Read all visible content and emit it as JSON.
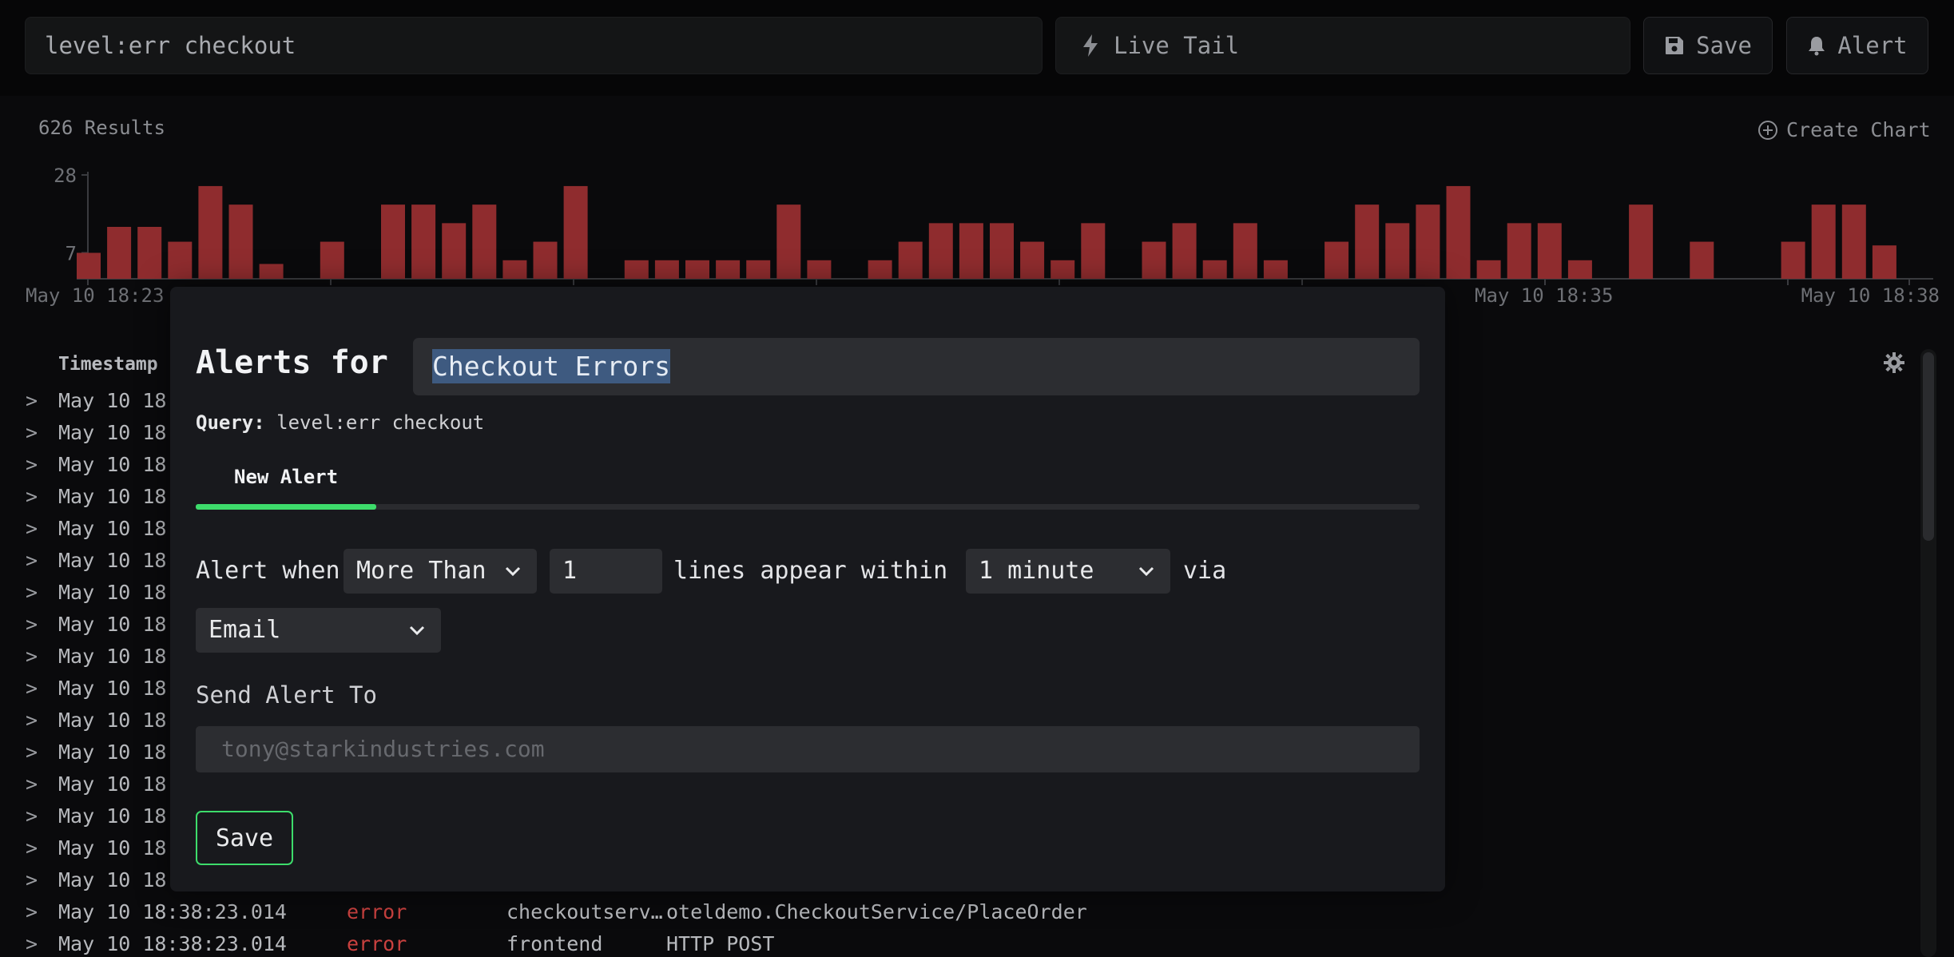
{
  "topbar": {
    "query": "level:err checkout",
    "live_tail": "Live Tail",
    "save": "Save",
    "alert": "Alert"
  },
  "results": {
    "count": "626 Results",
    "create_chart": "Create Chart"
  },
  "chart_data": {
    "type": "bar",
    "y_ticks": [
      "28",
      "7"
    ],
    "x_ticks": [
      "May 10 18:23",
      "May 10 18:35",
      "May 10 18:38"
    ],
    "ylim": [
      0,
      28
    ],
    "values": [
      7,
      14,
      14,
      10,
      25,
      20,
      4,
      0,
      10,
      0,
      20,
      20,
      15,
      20,
      5,
      10,
      25,
      0,
      5,
      5,
      5,
      5,
      5,
      20,
      5,
      0,
      5,
      10,
      15,
      15,
      15,
      10,
      5,
      15,
      0,
      10,
      15,
      5,
      15,
      5,
      0,
      10,
      20,
      15,
      20,
      25,
      5,
      15,
      15,
      5,
      0,
      20,
      0,
      10,
      0,
      0,
      10,
      20,
      20,
      9,
      0
    ]
  },
  "logs": {
    "header_timestamp": "Timestamp",
    "partial_timestamps": [
      "May 10 18:",
      "May 10 18:",
      "May 10 18:",
      "May 10 18:",
      "May 10 18:",
      "May 10 18:",
      "May 10 18:",
      "May 10 18:",
      "May 10 18:",
      "May 10 18:",
      "May 10 18:",
      "May 10 18:",
      "May 10 18:",
      "May 10 18:",
      "May 10 18:",
      "May 10 18:"
    ],
    "rows": [
      {
        "timestamp": "May 10 18:38:23.014",
        "level": "error",
        "service": "checkoutserv…",
        "message": "oteldemo.CheckoutService/PlaceOrder"
      },
      {
        "timestamp": "May 10 18:38:23.014",
        "level": "error",
        "service": "frontend",
        "message": "HTTP POST"
      }
    ],
    "chevron": ">"
  },
  "modal": {
    "title": "Alerts for",
    "alert_name": "Checkout Errors",
    "query_label": "Query:",
    "query_value": "level:err checkout",
    "tab": "New Alert",
    "alert_when": "Alert when",
    "condition": "More Than",
    "threshold": "1",
    "lines_appear_within": "lines appear within",
    "window": "1 minute",
    "via": "via",
    "channel": "Email",
    "send_to_label": "Send Alert To",
    "send_to_placeholder": "tony@starkindustries.com",
    "save": "Save"
  },
  "colors": {
    "bar": "#8f2c2e",
    "accent_green": "#3ddc6b",
    "error_red": "#c9413f"
  }
}
